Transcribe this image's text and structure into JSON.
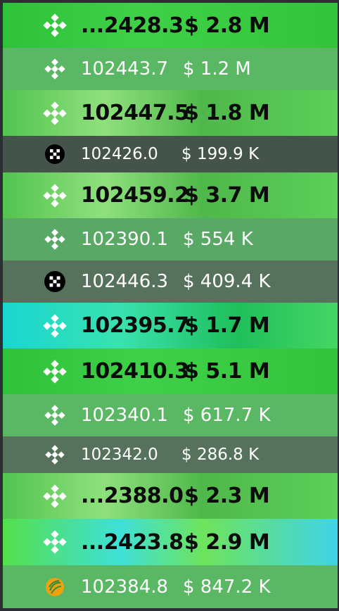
{
  "rows": [
    {
      "price": "...2428.3",
      "value": "$ 2.8 M",
      "icon": "bnb-icon"
    },
    {
      "price": "102443.7",
      "value": "$ 1.2 M",
      "icon": "bnb-icon"
    },
    {
      "price": "102447.5",
      "value": "$ 1.8 M",
      "icon": "bnb-icon"
    },
    {
      "price": "102426.0",
      "value": "$ 199.9 K",
      "icon": "okx-icon"
    },
    {
      "price": "102459.2",
      "value": "$ 3.7 M",
      "icon": "bnb-icon"
    },
    {
      "price": "102390.1",
      "value": "$ 554 K",
      "icon": "bnb-icon"
    },
    {
      "price": "102446.3",
      "value": "$ 409.4 K",
      "icon": "okx-icon"
    },
    {
      "price": "102395.7",
      "value": "$ 1.7 M",
      "icon": "bnb-icon"
    },
    {
      "price": "102410.3",
      "value": "$ 5.1 M",
      "icon": "bnb-icon"
    },
    {
      "price": "102340.1",
      "value": "$ 617.7 K",
      "icon": "bnb-icon"
    },
    {
      "price": "102342.0",
      "value": "$ 286.8 K",
      "icon": "bnb-icon"
    },
    {
      "price": "...2388.0",
      "value": "$ 2.3 M",
      "icon": "bnb-icon"
    },
    {
      "price": "...2423.8",
      "value": "$ 2.9 M",
      "icon": "bnb-icon"
    },
    {
      "price": "102384.8",
      "value": "$ 847.2 K",
      "icon": "bybit-icon"
    }
  ],
  "colors": {
    "accent_green": "#3ed147",
    "muted_green": "#5ab864",
    "dark_row": "#45544a",
    "big_text": "#0b0b0b",
    "small_text": "#ffffff"
  }
}
